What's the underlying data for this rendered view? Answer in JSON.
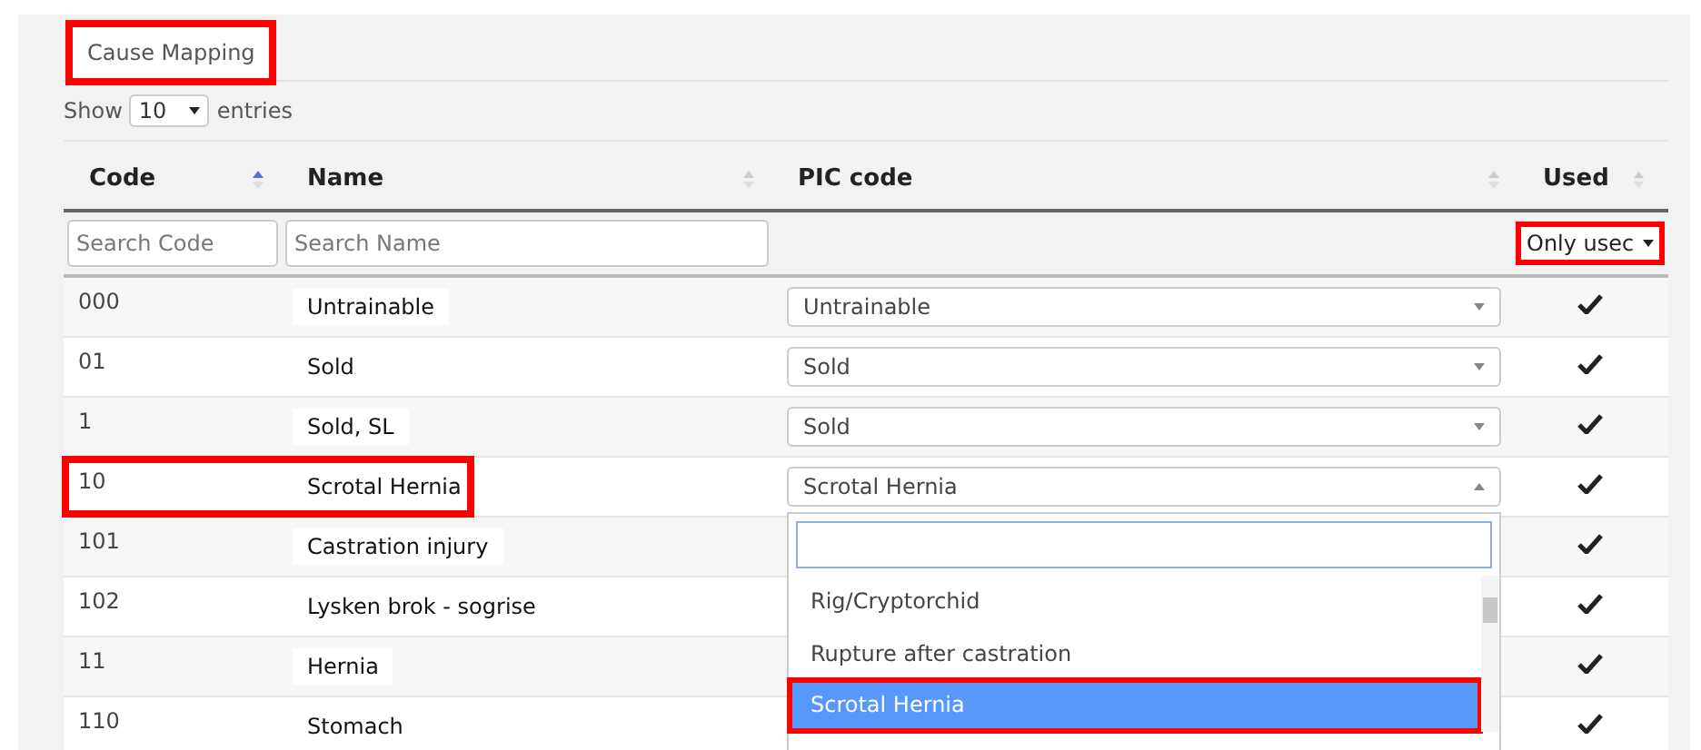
{
  "tabs": [
    {
      "label": "Cause Mapping",
      "selected": true,
      "annotated": true
    }
  ],
  "length_menu": {
    "before": "Show",
    "value": "10",
    "after": "entries"
  },
  "table": {
    "columns": [
      {
        "label": "Code",
        "sorted_ascending": true
      },
      {
        "label": "Name",
        "sorted_ascending": false
      },
      {
        "label": "PIC code",
        "sorted_ascending": false
      },
      {
        "label": "Used",
        "sorted_ascending": false
      }
    ],
    "filters": {
      "code_placeholder": "Search Code",
      "name_placeholder": "Search Name",
      "used_value": "Only usec",
      "used_annotated": true
    },
    "rows": [
      {
        "code": "000",
        "name": "Untrainable",
        "pic_code": "Untrainable",
        "used": true,
        "open": false,
        "annotated": false
      },
      {
        "code": "01",
        "name": "Sold",
        "pic_code": "Sold",
        "used": true,
        "open": false,
        "annotated": false
      },
      {
        "code": "1",
        "name": "Sold, SL",
        "pic_code": "Sold",
        "used": true,
        "open": false,
        "annotated": false
      },
      {
        "code": "10",
        "name": "Scrotal Hernia",
        "pic_code": "Scrotal Hernia",
        "used": true,
        "open": true,
        "annotated": true
      },
      {
        "code": "101",
        "name": "Castration injury",
        "used": true,
        "open": false,
        "annotated": false
      },
      {
        "code": "102",
        "name": "Lysken brok - sogrise",
        "used": true,
        "open": false,
        "annotated": false
      },
      {
        "code": "11",
        "name": "Hernia",
        "used": true,
        "open": false,
        "annotated": false
      },
      {
        "code": "110",
        "name": "Stomach",
        "used": true,
        "open": false,
        "annotated": false
      }
    ]
  },
  "dropdown": {
    "options": [
      {
        "label": "Rig/Cryptorchid",
        "selected": false,
        "annotated": false
      },
      {
        "label": "Rupture after castration",
        "selected": false,
        "annotated": false
      },
      {
        "label": "Scrotal Hernia",
        "selected": true,
        "annotated": true
      }
    ]
  }
}
